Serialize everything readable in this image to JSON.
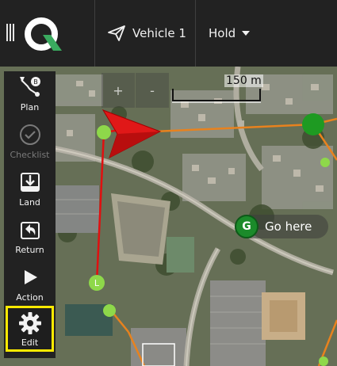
{
  "toolbar": {
    "vehicle_label": "Vehicle 1",
    "flight_mode": "Hold",
    "menu_icon": "hamburger-icon",
    "logo_icon": "qgc-logo-icon",
    "vehicle_icon": "paper-plane-icon",
    "colors": {
      "background": "#222222",
      "logo_green": "#3aaa5f"
    }
  },
  "tools": [
    {
      "label": "Plan",
      "icon": "plan-route-icon",
      "enabled": true,
      "selected": false
    },
    {
      "label": "Checklist",
      "icon": "checklist-icon",
      "enabled": false,
      "selected": false
    },
    {
      "label": "Land",
      "icon": "land-icon",
      "enabled": true,
      "selected": false
    },
    {
      "label": "Return",
      "icon": "return-icon",
      "enabled": true,
      "selected": false
    },
    {
      "label": "Action",
      "icon": "play-icon",
      "enabled": true,
      "selected": false
    },
    {
      "label": "Edit",
      "icon": "gear-icon",
      "enabled": true,
      "selected": true
    }
  ],
  "map": {
    "zoom_in": "+",
    "zoom_out": "-",
    "scale_label": "150 m",
    "goto_marker": "G",
    "goto_label": "Go here",
    "landing_marker": "L",
    "colors": {
      "mission_path": "#e8821e",
      "vehicle_trail": "#e01010",
      "vehicle_heading": "#e01818",
      "waypoint": "#8ed84a",
      "goto_green": "#1b8a2a",
      "selection": "#ffea00"
    }
  }
}
